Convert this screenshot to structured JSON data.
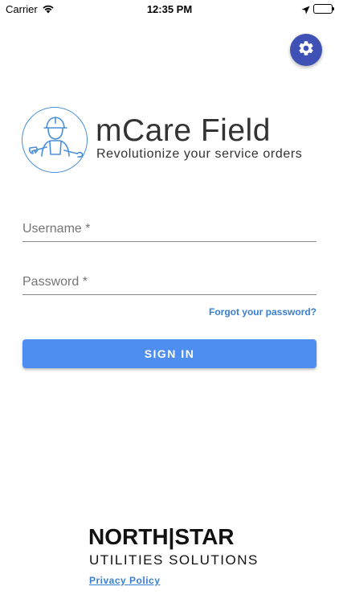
{
  "status_bar": {
    "carrier": "Carrier",
    "time": "12:35 PM",
    "icons": [
      "wifi-icon",
      "location-arrow-icon",
      "battery-icon"
    ]
  },
  "settings": {
    "icon": "gear-icon",
    "color": "#3f51b5"
  },
  "branding": {
    "logo_icon": "worker-wrench-icon",
    "title": "mCare Field",
    "subtitle": "Revolutionize your service orders",
    "accent": "#4a90d9"
  },
  "form": {
    "username_placeholder": "Username *",
    "password_placeholder": "Password *",
    "forgot_label": "Forgot your password?",
    "sign_in_label": "SIGN IN",
    "button_color": "#4d8ef0"
  },
  "footer": {
    "company": "NORTH|STAR",
    "tagline": "UTILITIES SOLUTIONS",
    "privacy_label": "Privacy Policy"
  }
}
